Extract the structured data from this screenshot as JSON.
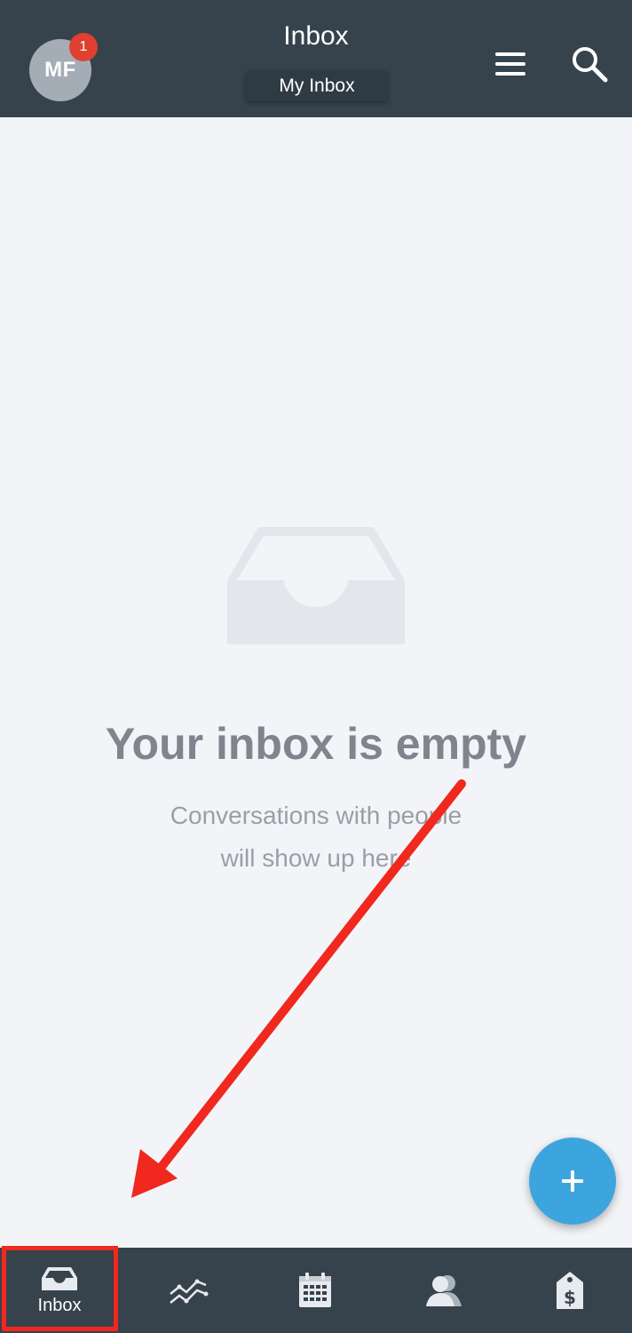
{
  "header": {
    "avatar_initials": "MF",
    "notification_count": "1",
    "title": "Inbox",
    "subtitle": "My Inbox",
    "icons": [
      "menu-icon",
      "search-icon"
    ]
  },
  "empty_state": {
    "icon": "inbox-tray-icon",
    "title": "Your inbox is empty",
    "subtitle_line1": "Conversations with people",
    "subtitle_line2": "will show up here"
  },
  "fab": {
    "icon": "plus-icon",
    "color": "#3da5de"
  },
  "bottom_nav": {
    "items": [
      {
        "id": "inbox",
        "label": "Inbox",
        "icon": "inbox-tray-icon",
        "active": true
      },
      {
        "id": "stats",
        "label": "",
        "icon": "line-chart-icon",
        "active": false
      },
      {
        "id": "calendar",
        "label": "",
        "icon": "calendar-icon",
        "active": false
      },
      {
        "id": "contacts",
        "label": "",
        "icon": "contacts-icon",
        "active": false
      },
      {
        "id": "deals",
        "label": "",
        "icon": "price-tag-icon",
        "active": false
      }
    ]
  },
  "colors": {
    "header_bg": "#36434d",
    "page_bg": "#f3f4f8",
    "badge": "#e0402f",
    "annotation": "#f0281e"
  }
}
